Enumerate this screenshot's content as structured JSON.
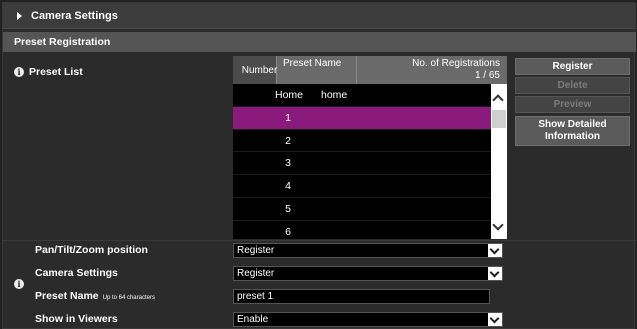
{
  "header": {
    "title": "Camera Settings"
  },
  "subheader": {
    "title": "Preset Registration"
  },
  "preset_list": {
    "label": "Preset List",
    "columns": {
      "number": "Number",
      "name": "Preset Name",
      "registrations": "No. of Registrations",
      "count": "1 / 65"
    },
    "rows": [
      {
        "number": "Home",
        "name": "home"
      },
      {
        "number": "1",
        "name": ""
      },
      {
        "number": "2",
        "name": ""
      },
      {
        "number": "3",
        "name": ""
      },
      {
        "number": "4",
        "name": ""
      },
      {
        "number": "5",
        "name": ""
      },
      {
        "number": "6",
        "name": ""
      }
    ],
    "selected_row": "1"
  },
  "buttons": {
    "register": "Register",
    "delete": "Delete",
    "preview": "Preview",
    "detail_line1": "Show Detailed",
    "detail_line2": "Information"
  },
  "form": {
    "ptz_label": "Pan/Tilt/Zoom position",
    "ptz_value": "Register",
    "camera_label": "Camera Settings",
    "camera_value": "Register",
    "name_label": "Preset Name",
    "name_hint": "Up to 64 characters",
    "name_value": "preset 1",
    "viewers_label": "Show in Viewers",
    "viewers_value": "Enable"
  },
  "colors": {
    "selected_row": "#8a1a7c"
  }
}
